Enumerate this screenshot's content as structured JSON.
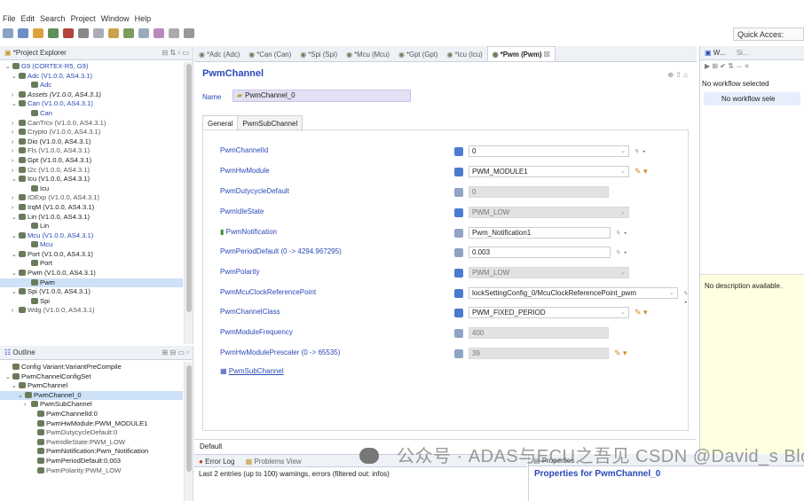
{
  "menu": [
    "File",
    "Edit",
    "Search",
    "Project",
    "Window",
    "Help"
  ],
  "quick_access": "Quick Acces:",
  "project_explorer": {
    "title": "*Project Explorer",
    "items": [
      {
        "text": "G9 (CORTEX-R5, G9)",
        "arrow": "v",
        "style": "blue",
        "indent": 0
      },
      {
        "text": "Adc (V1.0.0, AS4.3.1)",
        "arrow": "v",
        "style": "blue",
        "indent": 1
      },
      {
        "text": "Adc",
        "arrow": "",
        "style": "blue",
        "indent": 3
      },
      {
        "text": "Assets (V1.0.0, AS4.3.1)",
        "arrow": ">",
        "style": "dark",
        "indent": 1
      },
      {
        "text": "Can (V1.0.0, AS4.3.1)",
        "arrow": "v",
        "style": "blue",
        "indent": 1
      },
      {
        "text": "Can",
        "arrow": "",
        "style": "blue",
        "indent": 3
      },
      {
        "text": "CanTrcv (V1.0.0, AS4.3.1)",
        "arrow": ">",
        "style": "grey",
        "indent": 1
      },
      {
        "text": "Crypto (V1.0.0, AS4.3.1)",
        "arrow": ">",
        "style": "grey",
        "indent": 1
      },
      {
        "text": "Dio (V1.0.0, AS4.3.1)",
        "arrow": ">",
        "style": "dark",
        "indent": 1
      },
      {
        "text": "Fls (V1.0.0, AS4.3.1)",
        "arrow": ">",
        "style": "grey",
        "indent": 1
      },
      {
        "text": "Gpt (V1.0.0, AS4.3.1)",
        "arrow": ">",
        "style": "dark",
        "indent": 1
      },
      {
        "text": "I2c (V1.0.0, AS4.3.1)",
        "arrow": ">",
        "style": "grey",
        "indent": 1
      },
      {
        "text": "Icu (V1.0.0, AS4.3.1)",
        "arrow": "v",
        "style": "dark",
        "indent": 1
      },
      {
        "text": "Icu",
        "arrow": "",
        "style": "dark",
        "indent": 3
      },
      {
        "text": "IOExp (V1.0.0, AS4.3.1)",
        "arrow": ">",
        "style": "grey",
        "indent": 1
      },
      {
        "text": "IrqM (V1.0.0, AS4.3.1)",
        "arrow": ">",
        "style": "dark",
        "indent": 1
      },
      {
        "text": "Lin (V1.0.0, AS4.3.1)",
        "arrow": "v",
        "style": "dark",
        "indent": 1
      },
      {
        "text": "Lin",
        "arrow": "",
        "style": "dark",
        "indent": 3
      },
      {
        "text": "Mcu (V1.0.0, AS4.3.1)",
        "arrow": "v",
        "style": "blue",
        "indent": 1
      },
      {
        "text": "Mcu",
        "arrow": "",
        "style": "blue",
        "indent": 3
      },
      {
        "text": "Port (V1.0.0, AS4.3.1)",
        "arrow": "v",
        "style": "dark",
        "indent": 1
      },
      {
        "text": "Port",
        "arrow": "",
        "style": "dark",
        "indent": 3
      },
      {
        "text": "Pwm (V1.0.0, AS4.3.1)",
        "arrow": "v",
        "style": "dark",
        "indent": 1
      },
      {
        "text": "Pwm",
        "arrow": "",
        "style": "sel",
        "indent": 3
      },
      {
        "text": "Spi (V1.0.0, AS4.3.1)",
        "arrow": "v",
        "style": "dark",
        "indent": 1
      },
      {
        "text": "Spi",
        "arrow": "",
        "style": "dark",
        "indent": 3
      },
      {
        "text": "Wdg (V1.0.0, AS4.3.1)",
        "arrow": ">",
        "style": "grey",
        "indent": 1
      }
    ]
  },
  "outline": {
    "title": "Outline",
    "items": [
      {
        "text": "Config Variant:VariantPreCompile",
        "arrow": "",
        "style": "dark",
        "indent": 0
      },
      {
        "text": "PwmChannelConfigSet",
        "arrow": "v",
        "style": "dark",
        "indent": 0
      },
      {
        "text": "PwmChannel",
        "arrow": "v",
        "style": "dark",
        "indent": 1
      },
      {
        "text": "PwmChannel_0",
        "arrow": "v",
        "style": "sel",
        "indent": 2
      },
      {
        "text": "PwmSubChannel",
        "arrow": ">",
        "style": "dark",
        "indent": 3
      },
      {
        "text": "PwmChannelId:0",
        "arrow": "",
        "style": "dark",
        "indent": 4
      },
      {
        "text": "PwmHwModule:PWM_MODULE1",
        "arrow": "",
        "style": "dark",
        "indent": 4
      },
      {
        "text": "PwmDutycycleDefault:0",
        "arrow": "",
        "style": "grey",
        "indent": 4
      },
      {
        "text": "PwmIdleState:PWM_LOW",
        "arrow": "",
        "style": "grey",
        "indent": 4
      },
      {
        "text": "PwmNotification:Pwm_Notification",
        "arrow": "",
        "style": "dark",
        "indent": 4
      },
      {
        "text": "PwmPeriodDefault:0.003",
        "arrow": "",
        "style": "dark",
        "indent": 4
      },
      {
        "text": "PwmPolarity:PWM_LOW",
        "arrow": "",
        "style": "grey",
        "indent": 4
      }
    ]
  },
  "editor_tabs": [
    {
      "label": "*Adc (Adc)",
      "active": false
    },
    {
      "label": "*Can (Can)",
      "active": false
    },
    {
      "label": "*Spi (Spi)",
      "active": false
    },
    {
      "label": "*Mcu (Mcu)",
      "active": false
    },
    {
      "label": "*Gpt (Gpt)",
      "active": false
    },
    {
      "label": "*Icu (Icu)",
      "active": false
    },
    {
      "label": "*Pwm (Pwm)",
      "active": true
    }
  ],
  "editor": {
    "title": "PwmChannel",
    "name_label": "Name",
    "name_value": "PwmChannel_0",
    "inner_tabs": [
      "General",
      "PwmSubChannel"
    ],
    "params": [
      {
        "label": "PwmChannelId",
        "value": "0",
        "kind": "dropdown",
        "ro": false,
        "actions": "ᛃ ▾"
      },
      {
        "label": "PwmHwModule",
        "value": "PWM_MODULE1",
        "kind": "dropdown",
        "ro": false,
        "actions": "✎ ▾"
      },
      {
        "label": "PwmDutycycleDefault",
        "value": "0",
        "kind": "text",
        "ro": true,
        "actions": ""
      },
      {
        "label": "PwmIdleState",
        "value": "PWM_LOW",
        "kind": "dropdown",
        "ro": true,
        "actions": ""
      },
      {
        "label": "PwmNotification",
        "value": "Pwm_Notification1",
        "kind": "text",
        "ro": false,
        "actions": "ᛃ ▾"
      },
      {
        "label": "PwmPeriodDefault (0 -> 4294.967295)",
        "value": "0.003",
        "kind": "text",
        "ro": false,
        "actions": "ᛃ ▾"
      },
      {
        "label": "PwmPolarity",
        "value": "PWM_LOW",
        "kind": "dropdown",
        "ro": true,
        "actions": ""
      },
      {
        "label": "PwmMcuClockReferencePoint",
        "value": "lockSettingConfig_0/McuClockReferencePoint_pwm",
        "kind": "dropdown",
        "ro": false,
        "actions": "ᛃ ▾"
      },
      {
        "label": "PwmChannelClass",
        "value": "PWM_FIXED_PERIOD",
        "kind": "dropdown",
        "ro": false,
        "actions": "✎ ▾"
      },
      {
        "label": "PwmModuleFrequency",
        "value": "400",
        "kind": "text",
        "ro": true,
        "actions": ""
      },
      {
        "label": "PwmHwModulePrescaler (0 -> 65535)",
        "value": "39",
        "kind": "text",
        "ro": true,
        "actions": "✎ ▾"
      }
    ],
    "sub_link": "PwmSubChannel",
    "default_tab": "Default"
  },
  "error_log": {
    "tabs": [
      "Error Log",
      "Problems View"
    ],
    "text": "Last 2 entries (up to 100) warnings, errors (filtered out: infos)"
  },
  "properties": {
    "tab": "Properties",
    "title": "Properties for PwmChannel_0"
  },
  "right_panel": {
    "tab": "W...",
    "tab2": "Si...",
    "no_workflow": "No workflow selected",
    "no_workflow2": "No workflow sele",
    "description": "No description available."
  },
  "watermark": "公众号 · ADAS与ECU之吾见 CSDN @David_s Blog",
  "colors": {
    "accent": "#2a49b7",
    "selection": "#cde1f7",
    "name_field": "#e3e0f4",
    "desc_bg": "#ffffe1"
  }
}
